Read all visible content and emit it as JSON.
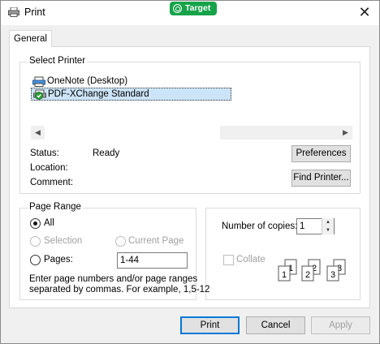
{
  "window": {
    "title": "Print",
    "close_symbol": "✕"
  },
  "badge": {
    "label": "Target"
  },
  "tabs": [
    {
      "label": "General"
    }
  ],
  "select_printer": {
    "group_label": "Select Printer",
    "printers": [
      {
        "name": "OneNote (Desktop)",
        "selected": false
      },
      {
        "name": "PDF-XChange Standard",
        "selected": true
      }
    ],
    "status_label": "Status:",
    "status_value": "Ready",
    "location_label": "Location:",
    "comment_label": "Comment:",
    "preferences_button": "Preferences",
    "find_printer_button": "Find Printer..."
  },
  "page_range": {
    "group_label": "Page Range",
    "all_label": "All",
    "selection_label": "Selection",
    "current_page_label": "Current Page",
    "pages_label": "Pages:",
    "pages_value": "1-44",
    "hint_line1": "Enter page numbers and/or page ranges",
    "hint_line2": "separated by commas.  For example, 1,5-12"
  },
  "copies": {
    "label": "Number of copies:",
    "value": "1",
    "collate_label": "Collate"
  },
  "buttons": {
    "print": "Print",
    "cancel": "Cancel",
    "apply": "Apply"
  },
  "colors": {
    "badge": "#16a34a",
    "selection": "#cce4f7",
    "default_button_border": "#0078d7"
  }
}
